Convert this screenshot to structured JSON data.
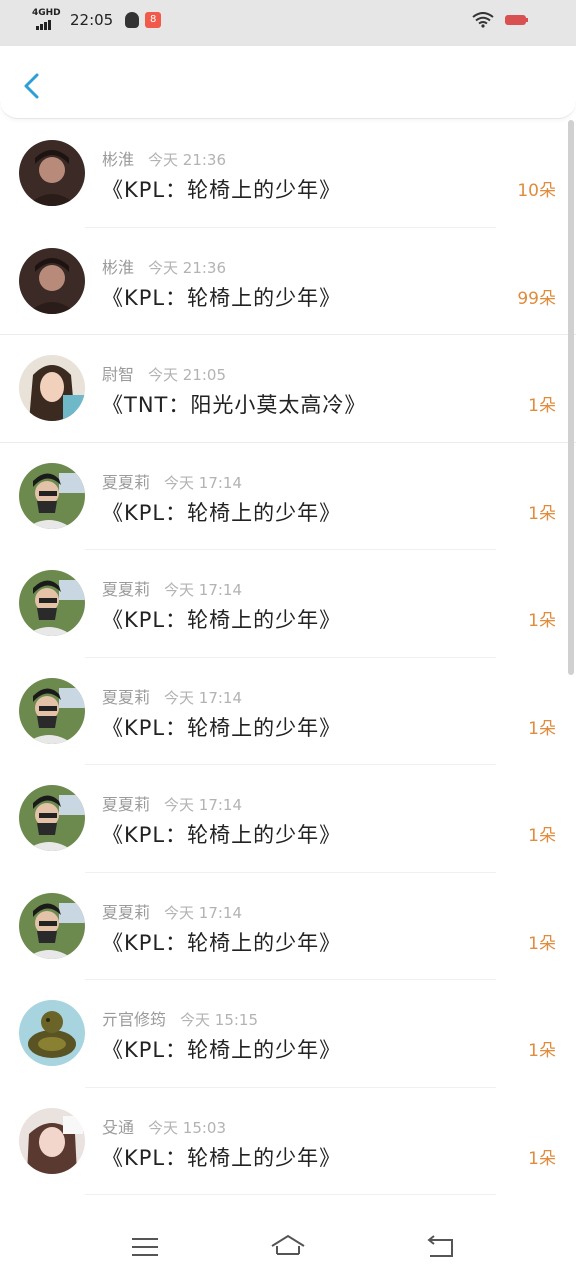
{
  "status_bar": {
    "network": "4GHD",
    "time": "22:05",
    "app_badge": "8"
  },
  "header": {
    "back_icon": "chevron-left-icon",
    "accent": "#2a9fd8"
  },
  "items": [
    {
      "name": "彬淮",
      "time": "今天 21:36",
      "title": "《KPL：轮椅上的少年》",
      "count": "10朵",
      "avatar": "man-dark"
    },
    {
      "name": "彬淮",
      "time": "今天 21:36",
      "title": "《KPL：轮椅上的少年》",
      "count": "99朵",
      "avatar": "man-dark"
    },
    {
      "name": "尉智",
      "time": "今天 21:05",
      "title": "《TNT：阳光小莫太高冷》",
      "count": "1朵",
      "avatar": "woman-light"
    },
    {
      "name": "夏夏莉",
      "time": "今天 17:14",
      "title": "《KPL：轮椅上的少年》",
      "count": "1朵",
      "avatar": "man-green"
    },
    {
      "name": "夏夏莉",
      "time": "今天 17:14",
      "title": "《KPL：轮椅上的少年》",
      "count": "1朵",
      "avatar": "man-green"
    },
    {
      "name": "夏夏莉",
      "time": "今天 17:14",
      "title": "《KPL：轮椅上的少年》",
      "count": "1朵",
      "avatar": "man-green"
    },
    {
      "name": "夏夏莉",
      "time": "今天 17:14",
      "title": "《KPL：轮椅上的少年》",
      "count": "1朵",
      "avatar": "man-green"
    },
    {
      "name": "夏夏莉",
      "time": "今天 17:14",
      "title": "《KPL：轮椅上的少年》",
      "count": "1朵",
      "avatar": "man-green"
    },
    {
      "name": "亓官修筠",
      "time": "今天 15:15",
      "title": "《KPL：轮椅上的少年》",
      "count": "1朵",
      "avatar": "dragon"
    },
    {
      "name": "殳通",
      "time": "今天 15:03",
      "title": "《KPL：轮椅上的少年》",
      "count": "1朵",
      "avatar": "woman-pink"
    }
  ],
  "colors": {
    "count": "#e08c3c",
    "meta": "#9b9b9b",
    "title": "#222222"
  },
  "nav": {
    "menu_icon": "menu-icon",
    "home_icon": "home-icon",
    "back_icon": "back-arrow-icon"
  }
}
